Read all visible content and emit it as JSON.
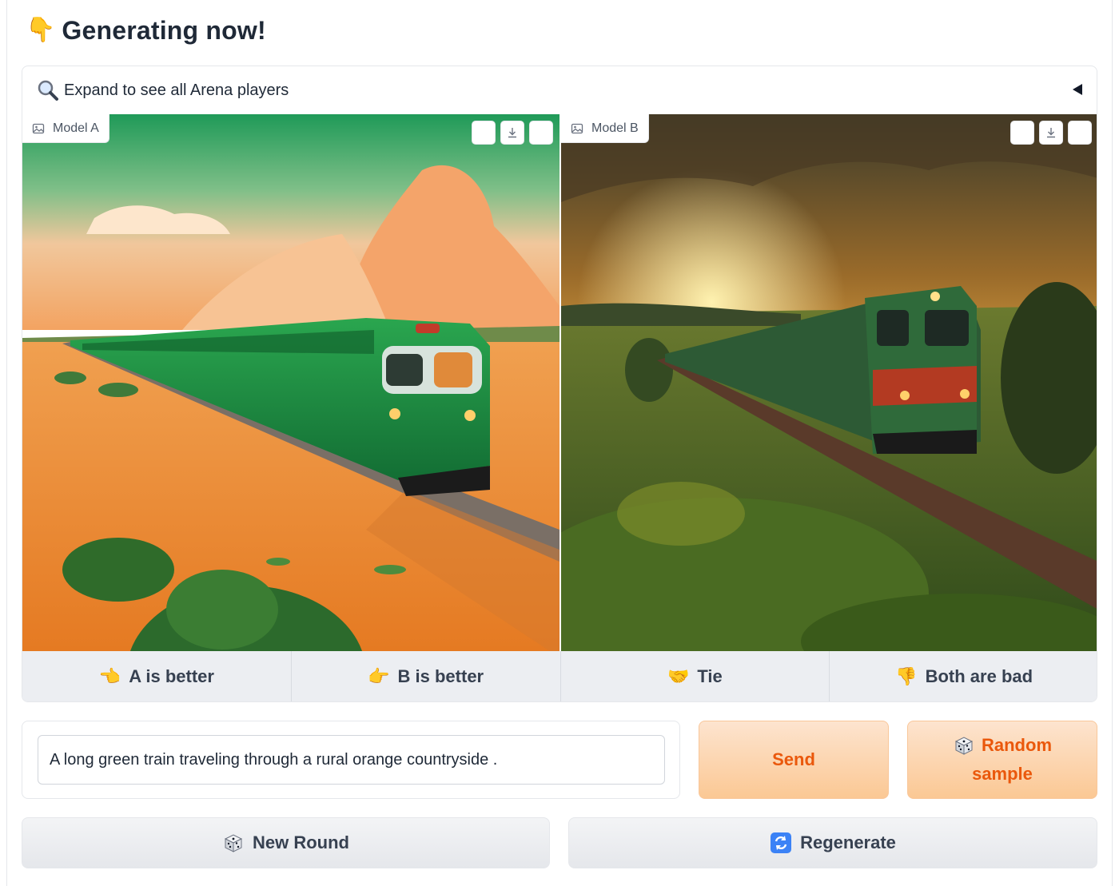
{
  "heading": {
    "emoji": "👇",
    "title": "Generating now!"
  },
  "accordion": {
    "icon": "magnifier-icon",
    "label": "Expand to see all Arena players"
  },
  "panels": {
    "a": {
      "label": "Model A",
      "image_alt": "A long green train traveling through an orange desert countryside"
    },
    "b": {
      "label": "Model B",
      "image_alt": "A green train traveling through green countryside at sunset"
    }
  },
  "votes": [
    {
      "emoji": "👈",
      "label": "A is better"
    },
    {
      "emoji": "👉",
      "label": "B is better"
    },
    {
      "emoji": "🤝",
      "label": "Tie"
    },
    {
      "emoji": "👎",
      "label": "Both are bad"
    }
  ],
  "prompt": {
    "value": "A long green train traveling through a rural orange countryside ."
  },
  "buttons": {
    "send": "Send",
    "random_line1": "Random",
    "random_line2": "sample",
    "new_round": "New Round",
    "regenerate": "Regenerate"
  },
  "colors": {
    "accent": "#ea580c",
    "button_gray": "#eceef2"
  }
}
